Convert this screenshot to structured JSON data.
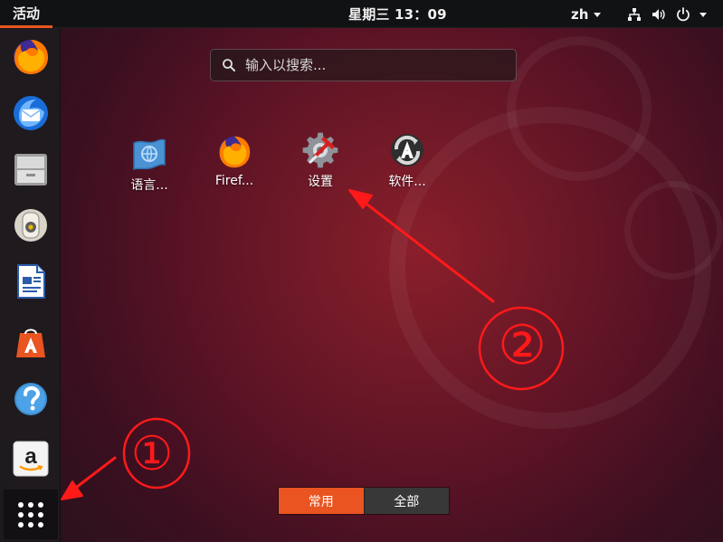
{
  "topbar": {
    "activities": "活动",
    "clock": "星期三 13：09",
    "language": "zh"
  },
  "search": {
    "placeholder": "输入以搜索..."
  },
  "dock": {
    "items": [
      {
        "icon": "firefox-icon"
      },
      {
        "icon": "thunderbird-icon"
      },
      {
        "icon": "files-icon"
      },
      {
        "icon": "rhythmbox-icon"
      },
      {
        "icon": "libreoffice-writer-icon"
      },
      {
        "icon": "ubuntu-software-icon"
      },
      {
        "icon": "help-icon"
      },
      {
        "icon": "amazon-icon"
      },
      {
        "icon": "show-applications-icon"
      }
    ]
  },
  "apps": [
    {
      "label": "语言...",
      "icon": "language-support-icon"
    },
    {
      "label": "Firef...",
      "icon": "firefox-icon"
    },
    {
      "label": "设置",
      "icon": "settings-icon"
    },
    {
      "label": "软件...",
      "icon": "software-updater-icon"
    }
  ],
  "tabs": {
    "frequent": "常用",
    "all": "全部"
  },
  "annotations": {
    "marker_one": "①",
    "marker_two": "②"
  },
  "colors": {
    "accent": "#e95420",
    "topbar": "#111214",
    "dock": "#1c1c1e",
    "annotation": "#ff1a1a"
  }
}
